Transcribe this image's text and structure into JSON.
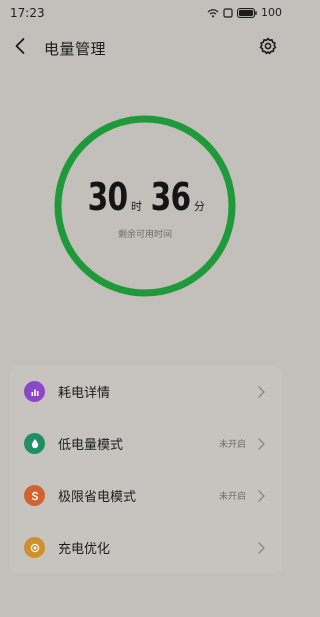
{
  "status_bar": {
    "time": "17:23",
    "battery": "100"
  },
  "header": {
    "title": "电量管理",
    "back_icon": "chevron-left-icon",
    "settings_icon": "gear-icon"
  },
  "battery_ring": {
    "hours": "30",
    "hours_unit": "时",
    "minutes": "36",
    "minutes_unit": "分",
    "caption": "剩余可用时间",
    "ring_color": "#1f9a3a"
  },
  "menu": {
    "items": [
      {
        "label": "耗电详情",
        "status": "",
        "icon": "bar-chart-icon",
        "icon_color": "#8a48c8"
      },
      {
        "label": "低电量模式",
        "status": "未开启",
        "icon": "drop-icon",
        "icon_color": "#1f8f66"
      },
      {
        "label": "极限省电模式",
        "status": "未开启",
        "icon": "s-circle-icon",
        "icon_color": "#d2622e"
      },
      {
        "label": "充电优化",
        "status": "",
        "icon": "dot-circle-icon",
        "icon_color": "#cf8f2c"
      }
    ]
  }
}
